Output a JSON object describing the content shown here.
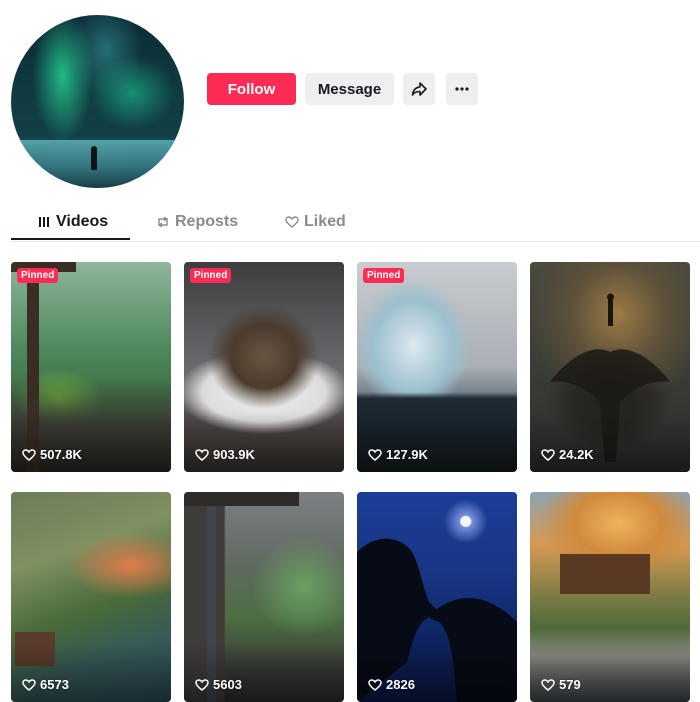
{
  "profile": {
    "follow_label": "Follow",
    "message_label": "Message"
  },
  "tabs": [
    {
      "label": "Videos",
      "icon": "grid-icon",
      "active": true
    },
    {
      "label": "Reposts",
      "icon": "repost-icon",
      "active": false
    },
    {
      "label": "Liked",
      "icon": "heart-icon",
      "active": false
    }
  ],
  "videos": [
    {
      "views": "507.8K",
      "pinned": "Pinned"
    },
    {
      "views": "903.9K",
      "pinned": "Pinned"
    },
    {
      "views": "127.9K",
      "pinned": "Pinned"
    },
    {
      "views": "24.2K"
    },
    {
      "views": "6573"
    },
    {
      "views": "5603"
    },
    {
      "views": "2826"
    },
    {
      "views": "579"
    }
  ],
  "colors": {
    "accent": "#fe2c55",
    "text_primary": "#161823",
    "text_secondary": "#8a8b91",
    "button_secondary": "#efefef"
  }
}
